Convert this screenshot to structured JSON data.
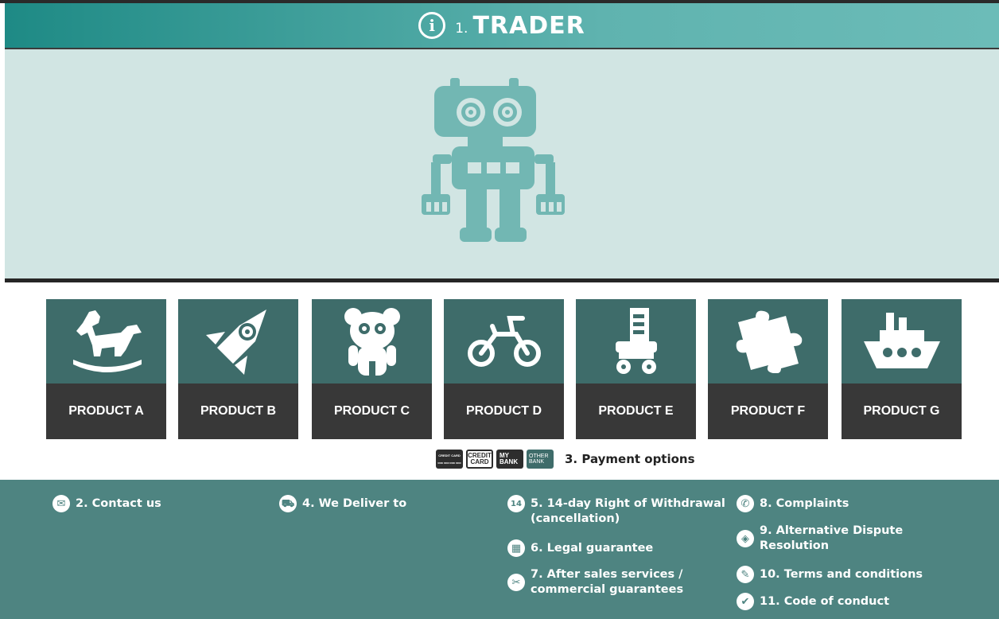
{
  "header": {
    "number": "1.",
    "title": "TRADER",
    "icon": "info-icon"
  },
  "colors": {
    "header_start": "#1e8a85",
    "header_end": "#6cbcb8",
    "hero_bg": "#d1e5e3",
    "robot": "#72b7b3",
    "product_icon_bg": "#3e6c6a",
    "product_label_bg": "#383838",
    "footer_bg": "#4e8481"
  },
  "hero": {
    "icon": "robot-icon"
  },
  "products": [
    {
      "label": "PRODUCT A",
      "icon": "rocking-horse-icon"
    },
    {
      "label": "PRODUCT B",
      "icon": "rocket-icon"
    },
    {
      "label": "PRODUCT C",
      "icon": "teddy-bear-icon"
    },
    {
      "label": "PRODUCT D",
      "icon": "bicycle-icon"
    },
    {
      "label": "PRODUCT E",
      "icon": "roller-skate-icon"
    },
    {
      "label": "PRODUCT F",
      "icon": "puzzle-icon"
    },
    {
      "label": "PRODUCT G",
      "icon": "ship-icon"
    }
  ],
  "payment": {
    "label": "3. Payment options",
    "cards": [
      {
        "lines": [
          "CREDIT CARD",
          "0000 0000 0000 0000"
        ],
        "style": "dark"
      },
      {
        "lines": [
          "CREDIT",
          "CARD"
        ],
        "style": "light"
      },
      {
        "lines": [
          "MY",
          "BANK"
        ],
        "style": "dark"
      },
      {
        "lines": [
          "OTHER",
          "BANK"
        ],
        "style": "teal"
      }
    ]
  },
  "footer": {
    "contact": {
      "label": "2. Contact us",
      "icon": "envelope-icon"
    },
    "deliver": {
      "label": "4. We Deliver to",
      "icon": "truck-icon"
    },
    "withdrawal": {
      "line1": "5. 14-day Right of Withdrawal",
      "line2": "(cancellation)",
      "icon": "calendar-14-icon",
      "badge": "14"
    },
    "legal": {
      "label": "6. Legal guarantee",
      "icon": "calendar-icon"
    },
    "after_sales": {
      "line1": "7. After sales services /",
      "line2": "commercial guarantees",
      "icon": "tools-icon"
    },
    "complaints": {
      "label": "8. Complaints",
      "icon": "phone-icon"
    },
    "adr": {
      "line1": "9. Alternative Dispute",
      "line2": "Resolution",
      "icon": "handshake-icon"
    },
    "terms": {
      "label": "10. Terms and conditions",
      "icon": "document-icon"
    },
    "conduct": {
      "label": "11. Code of conduct",
      "icon": "checkmark-icon"
    }
  }
}
